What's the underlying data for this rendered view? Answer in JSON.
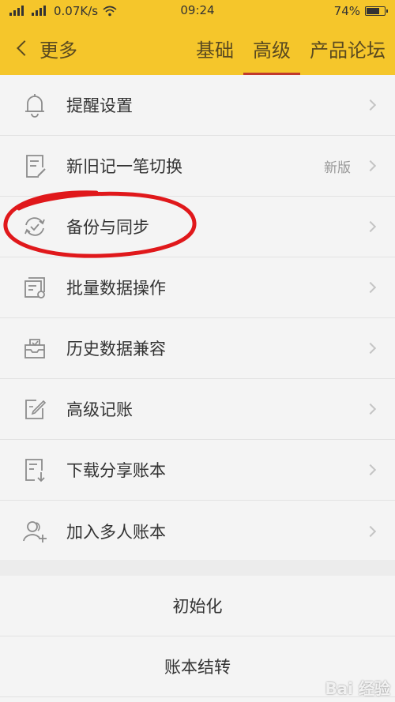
{
  "status": {
    "network": "0.07K/s",
    "time": "09:24",
    "battery": "74%",
    "battery_level": 0.74
  },
  "header": {
    "back_label": "更多",
    "tabs": [
      {
        "label": "基础",
        "active": false
      },
      {
        "label": "高级",
        "active": true
      },
      {
        "label": "产品论坛",
        "active": false
      }
    ]
  },
  "menu": {
    "items": [
      {
        "label": "提醒设置",
        "icon": "bell-icon",
        "badge": ""
      },
      {
        "label": "新旧记一笔切换",
        "icon": "edit-document-icon",
        "badge": "新版"
      },
      {
        "label": "备份与同步",
        "icon": "sync-icon",
        "badge": ""
      },
      {
        "label": "批量数据操作",
        "icon": "batch-settings-icon",
        "badge": ""
      },
      {
        "label": "历史数据兼容",
        "icon": "inbox-icon",
        "badge": ""
      },
      {
        "label": "高级记账",
        "icon": "pencil-square-icon",
        "badge": ""
      },
      {
        "label": "下载分享账本",
        "icon": "download-book-icon",
        "badge": ""
      },
      {
        "label": "加入多人账本",
        "icon": "add-user-icon",
        "badge": ""
      }
    ]
  },
  "actions": {
    "init_label": "初始化",
    "carryover_label": "账本结转"
  },
  "watermark": "Bai 经验",
  "colors": {
    "header_bg": "#f5c62b",
    "active_tab_underline": "#c0392b",
    "annotation_circle": "#e0181b"
  }
}
